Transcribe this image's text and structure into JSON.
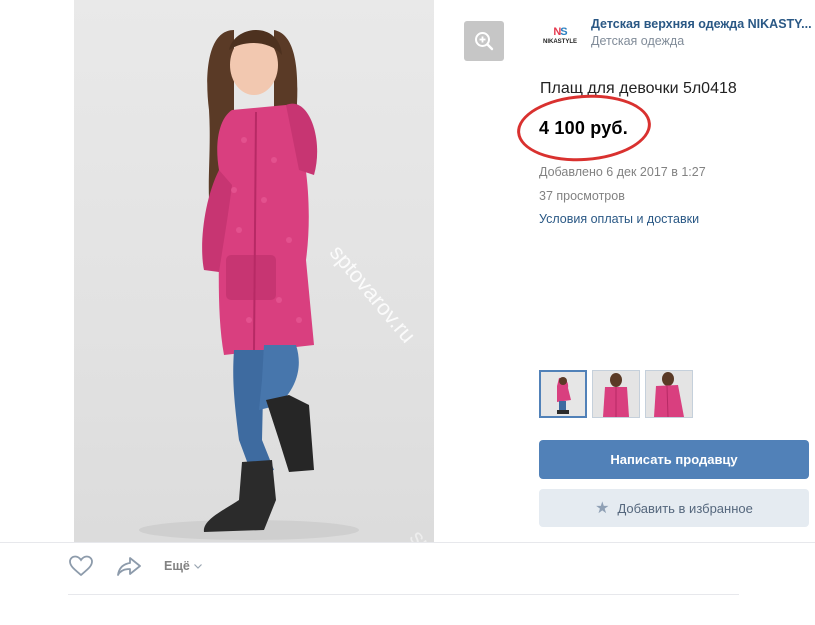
{
  "shop": {
    "logo_text": "NIKASTYLE",
    "name": "Детская верхняя одежда NIKASTY...",
    "category": "Детская одежда"
  },
  "product": {
    "title": "Плащ для девочки 5л0418",
    "price": "4 100 руб.",
    "added": "Добавлено 6 дек 2017 в 1:27",
    "views": "37 просмотров",
    "terms_link": "Условия оплаты и доставки"
  },
  "watermark": {
    "text": "sptovarov.ru"
  },
  "buttons": {
    "contact_seller": "Написать продавцу",
    "add_favorite": "Добавить в избранное"
  },
  "actions": {
    "more": "Ещё"
  },
  "thumbnails": [
    {
      "name": "thumb-1",
      "active": true
    },
    {
      "name": "thumb-2",
      "active": false
    },
    {
      "name": "thumb-3",
      "active": false
    }
  ],
  "colors": {
    "accent": "#5181b8",
    "link": "#2a5885",
    "annotation_circle": "#d9312f",
    "jacket_pink": "#d93f7f"
  },
  "icons": {
    "zoom": "zoom-in-icon",
    "like": "heart-icon",
    "share": "share-arrow-icon",
    "favorite": "star-icon",
    "dropdown": "chevron-down-icon"
  }
}
